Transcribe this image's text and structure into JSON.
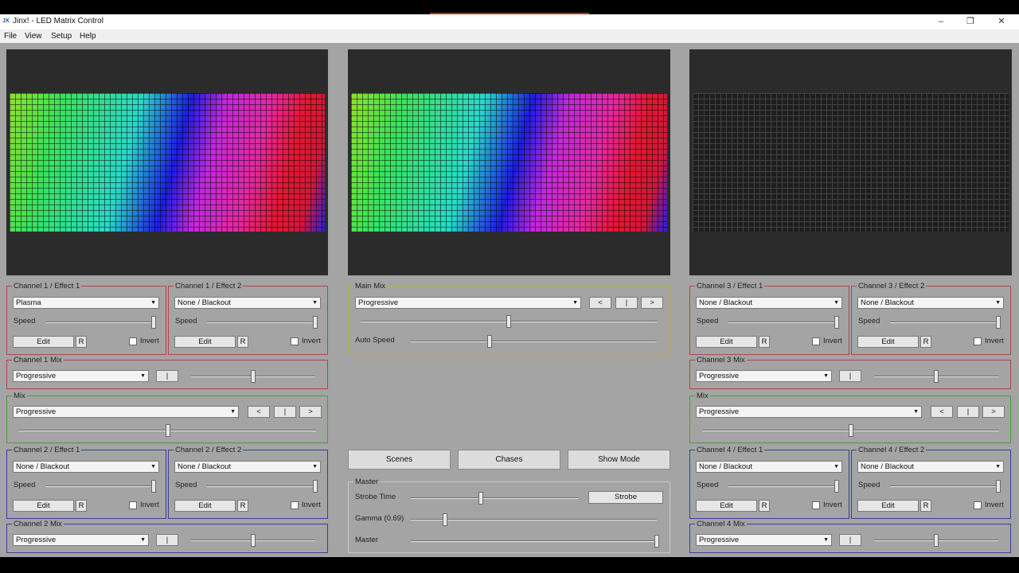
{
  "window": {
    "title": "Jinx! - LED Matrix Control",
    "logo": "JX",
    "min": "–",
    "restore": "❐",
    "close": "✕"
  },
  "menu": [
    "File",
    "View",
    "Setup",
    "Help"
  ],
  "colors": {
    "background": "#a4a4a4",
    "red_group": "#b04545",
    "green_group": "#4a9a3a",
    "blue_group": "#3a3e9a",
    "yellow_group": "#b8b040"
  },
  "effects": {
    "c1e1": {
      "title": "Channel 1 / Effect 1",
      "value": "Plasma",
      "speed": "Speed",
      "edit": "Edit",
      "r": "R",
      "invert": "Invert",
      "speed_level": 1.0
    },
    "c1e2": {
      "title": "Channel 1 / Effect 2",
      "value": "None / Blackout",
      "speed": "Speed",
      "edit": "Edit",
      "r": "R",
      "invert": "Invert",
      "speed_level": 1.0
    },
    "c2e1": {
      "title": "Channel 2 / Effect 1",
      "value": "None / Blackout",
      "speed": "Speed",
      "edit": "Edit",
      "r": "R",
      "invert": "Invert",
      "speed_level": 1.0
    },
    "c2e2": {
      "title": "Channel 2 / Effect 2",
      "value": "None / Blackout",
      "speed": "Speed",
      "edit": "Edit",
      "r": "R",
      "invert": "Invert",
      "speed_level": 1.0
    },
    "c3e1": {
      "title": "Channel 3 / Effect 1",
      "value": "None / Blackout",
      "speed": "Speed",
      "edit": "Edit",
      "r": "R",
      "invert": "Invert",
      "speed_level": 1.0
    },
    "c3e2": {
      "title": "Channel 3 / Effect 2",
      "value": "None / Blackout",
      "speed": "Speed",
      "edit": "Edit",
      "r": "R",
      "invert": "Invert",
      "speed_level": 1.0
    },
    "c4e1": {
      "title": "Channel 4 / Effect 1",
      "value": "None / Blackout",
      "speed": "Speed",
      "edit": "Edit",
      "r": "R",
      "invert": "Invert",
      "speed_level": 1.0
    },
    "c4e2": {
      "title": "Channel 4 / Effect 2",
      "value": "None / Blackout",
      "speed": "Speed",
      "edit": "Edit",
      "r": "R",
      "invert": "Invert",
      "speed_level": 1.0
    }
  },
  "chmix": {
    "c1": {
      "title": "Channel 1 Mix",
      "value": "Progressive",
      "btn": "|",
      "level": 0.5
    },
    "c2": {
      "title": "Channel 2 Mix",
      "value": "Progressive",
      "btn": "|",
      "level": 0.5
    },
    "c3": {
      "title": "Channel 3 Mix",
      "value": "Progressive",
      "btn": "|",
      "level": 0.5
    },
    "c4": {
      "title": "Channel 4 Mix",
      "value": "Progressive",
      "btn": "|",
      "level": 0.5
    }
  },
  "mix": {
    "left": {
      "title": "Mix",
      "value": "Progressive",
      "prev": "<",
      "mid": "|",
      "next": ">",
      "level": 0.5
    },
    "right": {
      "title": "Mix",
      "value": "Progressive",
      "prev": "<",
      "mid": "|",
      "next": ">",
      "level": 0.5
    }
  },
  "mainmix": {
    "title": "Main Mix",
    "value": "Progressive",
    "prev": "<",
    "mid": "|",
    "next": ">",
    "level": 0.5,
    "auto_speed": "Auto Speed",
    "auto_level": 0.32
  },
  "buttons": {
    "scenes": "Scenes",
    "chases": "Chases",
    "showmode": "Show Mode"
  },
  "master": {
    "title": "Master",
    "strobe_time": "Strobe Time",
    "strobe": "Strobe",
    "gamma": "Gamma (0.69)",
    "master": "Master",
    "strobe_level": 0.42,
    "gamma_level": 0.14,
    "master_level": 1.0
  }
}
